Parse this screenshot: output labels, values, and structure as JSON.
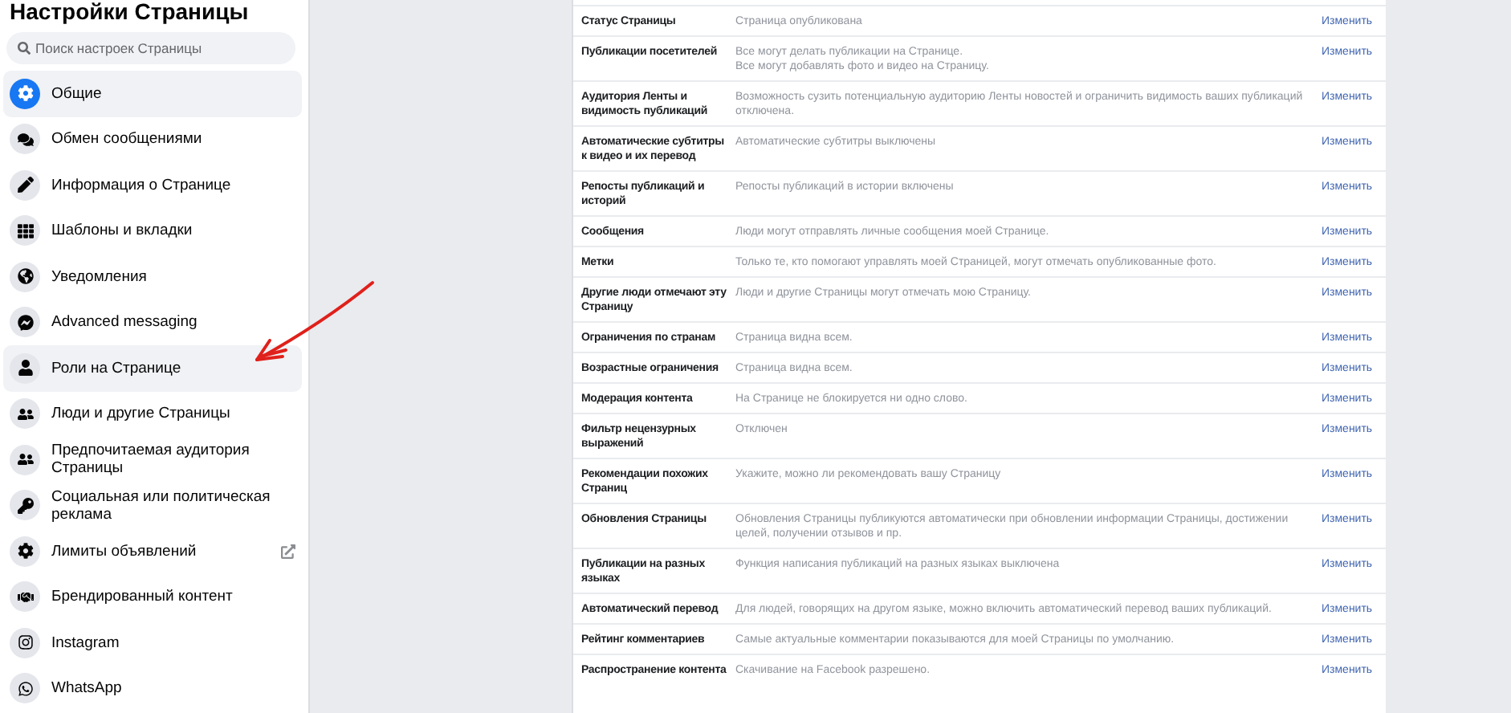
{
  "sidebar": {
    "title": "Настройки Страницы",
    "search": {
      "placeholder": "Поиск настроек Страницы"
    },
    "items": [
      {
        "label": "Общие",
        "selected": true,
        "hovered": false,
        "external": false
      },
      {
        "label": "Обмен сообщениями",
        "selected": false,
        "hovered": false,
        "external": false
      },
      {
        "label": "Информация о Странице",
        "selected": false,
        "hovered": false,
        "external": false
      },
      {
        "label": "Шаблоны и вкладки",
        "selected": false,
        "hovered": false,
        "external": false
      },
      {
        "label": "Уведомления",
        "selected": false,
        "hovered": false,
        "external": false
      },
      {
        "label": "Advanced messaging",
        "selected": false,
        "hovered": false,
        "external": false
      },
      {
        "label": "Роли на Странице",
        "selected": false,
        "hovered": true,
        "external": false
      },
      {
        "label": "Люди и другие Страницы",
        "selected": false,
        "hovered": false,
        "external": false
      },
      {
        "label": "Предпочитаемая аудитория Страницы",
        "selected": false,
        "hovered": false,
        "external": false
      },
      {
        "label": "Социальная или политическая реклама",
        "selected": false,
        "hovered": false,
        "external": false
      },
      {
        "label": "Лимиты объявлений",
        "selected": false,
        "hovered": false,
        "external": true
      },
      {
        "label": "Брендированный контент",
        "selected": false,
        "hovered": false,
        "external": false
      },
      {
        "label": "Instagram",
        "selected": false,
        "hovered": false,
        "external": false
      },
      {
        "label": "WhatsApp",
        "selected": false,
        "hovered": false,
        "external": false
      }
    ]
  },
  "settings": [
    {
      "name": "Статус Страницы",
      "value": "Страница опубликована",
      "action": "Изменить"
    },
    {
      "name": "Публикации посетителей",
      "value": "Все могут делать публикации на Странице.\nВсе могут добавлять фото и видео на Страницу.",
      "action": "Изменить"
    },
    {
      "name": "Аудитория Ленты и видимость публикаций",
      "value": "Возможность сузить потенциальную аудиторию Ленты новостей и ограничить видимость ваших публикаций отключена.",
      "action": "Изменить"
    },
    {
      "name": "Автоматические субтитры к видео и их перевод",
      "value": "Автоматические субтитры выключены",
      "action": "Изменить"
    },
    {
      "name": "Репосты публикаций и историй",
      "value": "Репосты публикаций в истории включены",
      "action": "Изменить"
    },
    {
      "name": "Сообщения",
      "value": "Люди могут отправлять личные сообщения моей Странице.",
      "action": "Изменить"
    },
    {
      "name": "Метки",
      "value": "Только те, кто помогают управлять моей Страницей, могут отмечать опубликованные фото.",
      "action": "Изменить"
    },
    {
      "name": "Другие люди отмечают эту Страницу",
      "value": "Люди и другие Страницы могут отмечать мою Страницу.",
      "action": "Изменить"
    },
    {
      "name": "Ограничения по странам",
      "value": "Страница видна всем.",
      "action": "Изменить"
    },
    {
      "name": "Возрастные ограничения",
      "value": "Страница видна всем.",
      "action": "Изменить"
    },
    {
      "name": "Модерация контента",
      "value": "На Странице не блокируется ни одно слово.",
      "action": "Изменить"
    },
    {
      "name": "Фильтр нецензурных выражений",
      "value": "Отключен",
      "action": "Изменить"
    },
    {
      "name": "Рекомендации похожих Страниц",
      "value": "Укажите, можно ли рекомендовать вашу Страницу",
      "action": "Изменить"
    },
    {
      "name": "Обновления Страницы",
      "value": "Обновления Страницы публикуются автоматически при обновлении информации Страницы, достижении целей, получении отзывов и пр.",
      "action": "Изменить"
    },
    {
      "name": "Публикации на разных языках",
      "value": "Функция написания публикаций на разных языках выключена",
      "action": "Изменить"
    },
    {
      "name": "Автоматический перевод",
      "value": "Для людей, говорящих на другом языке, можно включить автоматический перевод ваших публикаций.",
      "action": "Изменить"
    },
    {
      "name": "Рейтинг комментариев",
      "value": "Самые актуальные комментарии показываются для моей Страницы по умолчанию.",
      "action": "Изменить"
    },
    {
      "name": "Распространение контента",
      "value": "Скачивание на Facebook разрешено.",
      "action": "Изменить"
    }
  ]
}
